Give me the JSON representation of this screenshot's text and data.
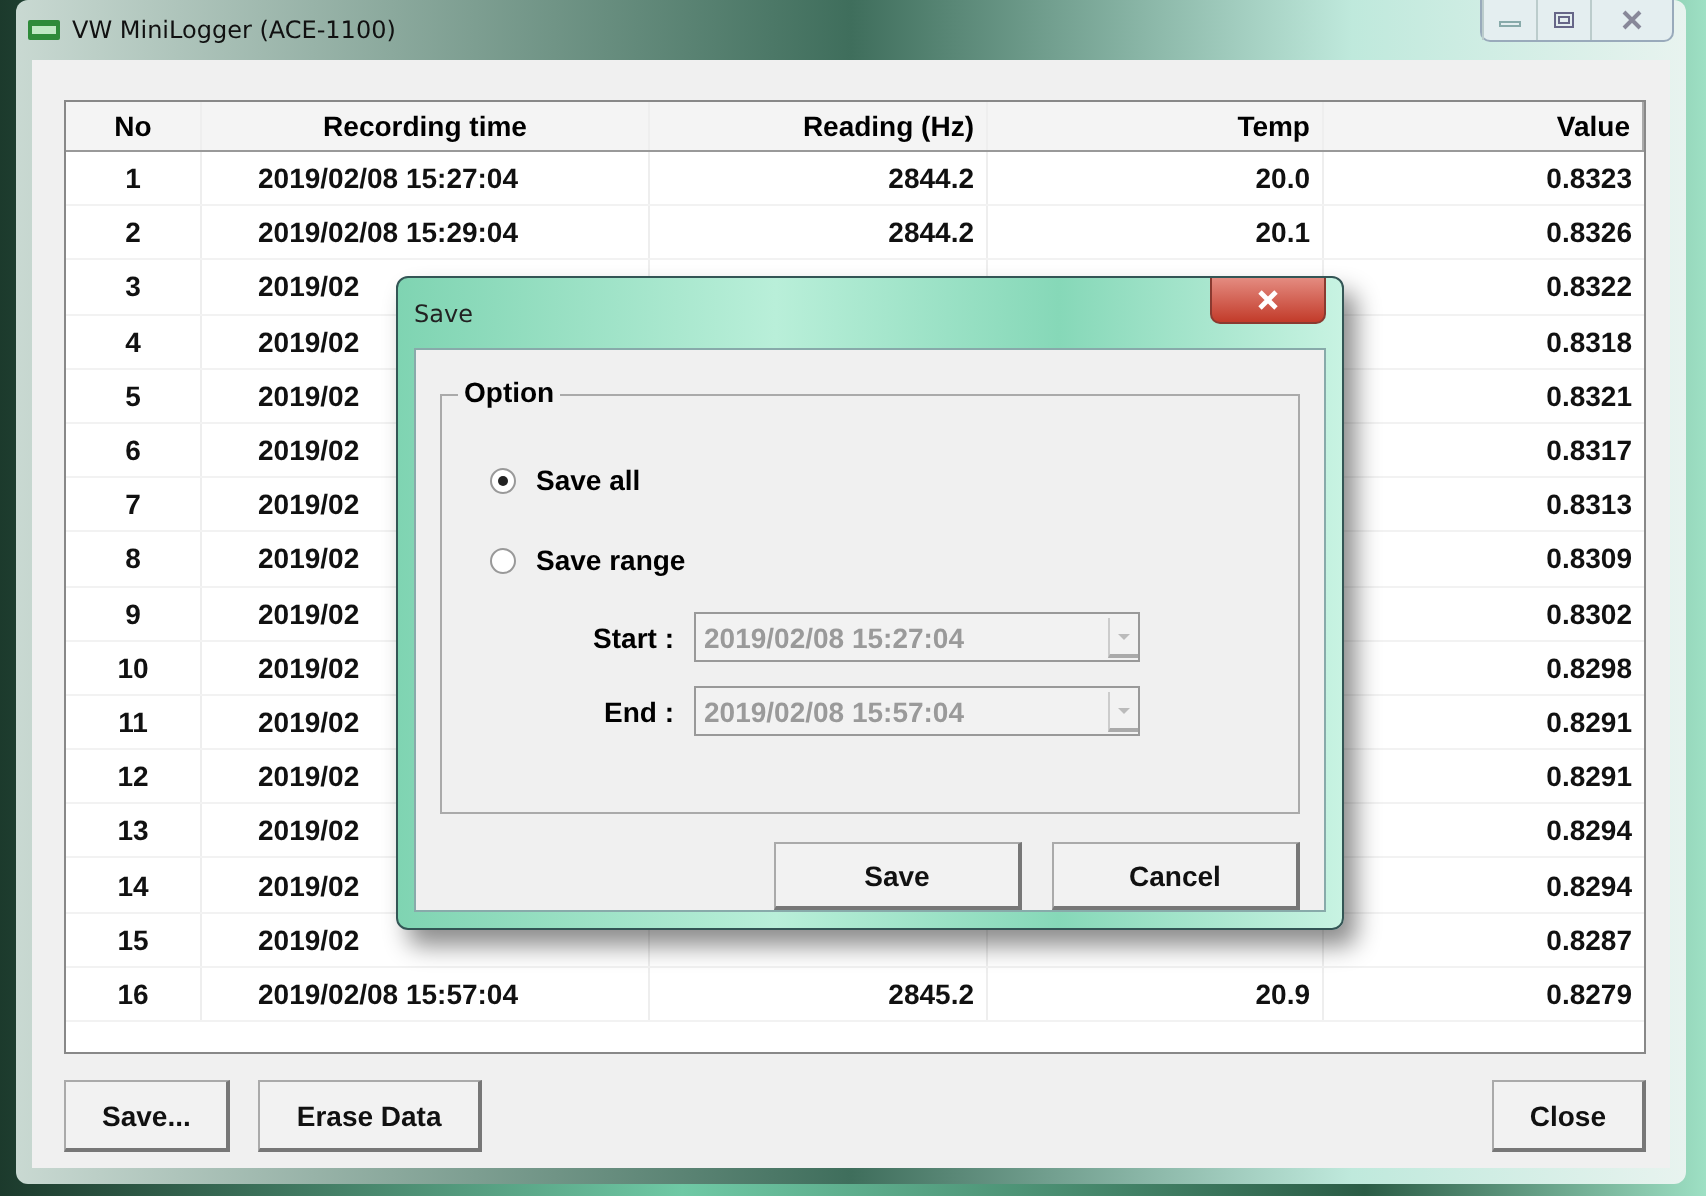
{
  "window": {
    "title": "VW MiniLogger (ACE-1100)"
  },
  "table": {
    "columns": [
      "No",
      "Recording time",
      "Reading (Hz)",
      "Temp",
      "Value"
    ],
    "rows": [
      {
        "no": "1",
        "time": "2019/02/08 15:27:04",
        "reading": "2844.2",
        "temp": "20.0",
        "value": "0.8323"
      },
      {
        "no": "2",
        "time": "2019/02/08 15:29:04",
        "reading": "2844.2",
        "temp": "20.1",
        "value": "0.8326"
      },
      {
        "no": "3",
        "time": "2019/02",
        "value": "0.8322"
      },
      {
        "no": "4",
        "time": "2019/02",
        "value": "0.8318"
      },
      {
        "no": "5",
        "time": "2019/02",
        "value": "0.8321"
      },
      {
        "no": "6",
        "time": "2019/02",
        "value": "0.8317"
      },
      {
        "no": "7",
        "time": "2019/02",
        "value": "0.8313"
      },
      {
        "no": "8",
        "time": "2019/02",
        "value": "0.8309"
      },
      {
        "no": "9",
        "time": "2019/02",
        "value": "0.8302"
      },
      {
        "no": "10",
        "time": "2019/02",
        "value": "0.8298"
      },
      {
        "no": "11",
        "time": "2019/02",
        "value": "0.8291"
      },
      {
        "no": "12",
        "time": "2019/02",
        "value": "0.8291"
      },
      {
        "no": "13",
        "time": "2019/02",
        "value": "0.8294"
      },
      {
        "no": "14",
        "time": "2019/02",
        "value": "0.8294"
      },
      {
        "no": "15",
        "time": "2019/02",
        "value": "0.8287"
      },
      {
        "no": "16",
        "time": "2019/02/08 15:57:04",
        "reading": "2845.2",
        "temp": "20.9",
        "value": "0.8279"
      }
    ]
  },
  "left_buttons": [
    "Save...",
    "Erase Data"
  ],
  "right_buttons": [
    "Close"
  ],
  "dialog": {
    "title": "Save",
    "group": "Option",
    "options": [
      {
        "label": "Save all",
        "selected": true
      },
      {
        "label": "Save range",
        "selected": false
      }
    ],
    "range": [
      {
        "label": "Start :",
        "value": "2019/02/08 15:27:04",
        "disabled": true
      },
      {
        "label": "End :",
        "value": "2019/02/08 15:57:04",
        "disabled": true
      }
    ],
    "buttons": [
      "Save",
      "Cancel"
    ]
  }
}
